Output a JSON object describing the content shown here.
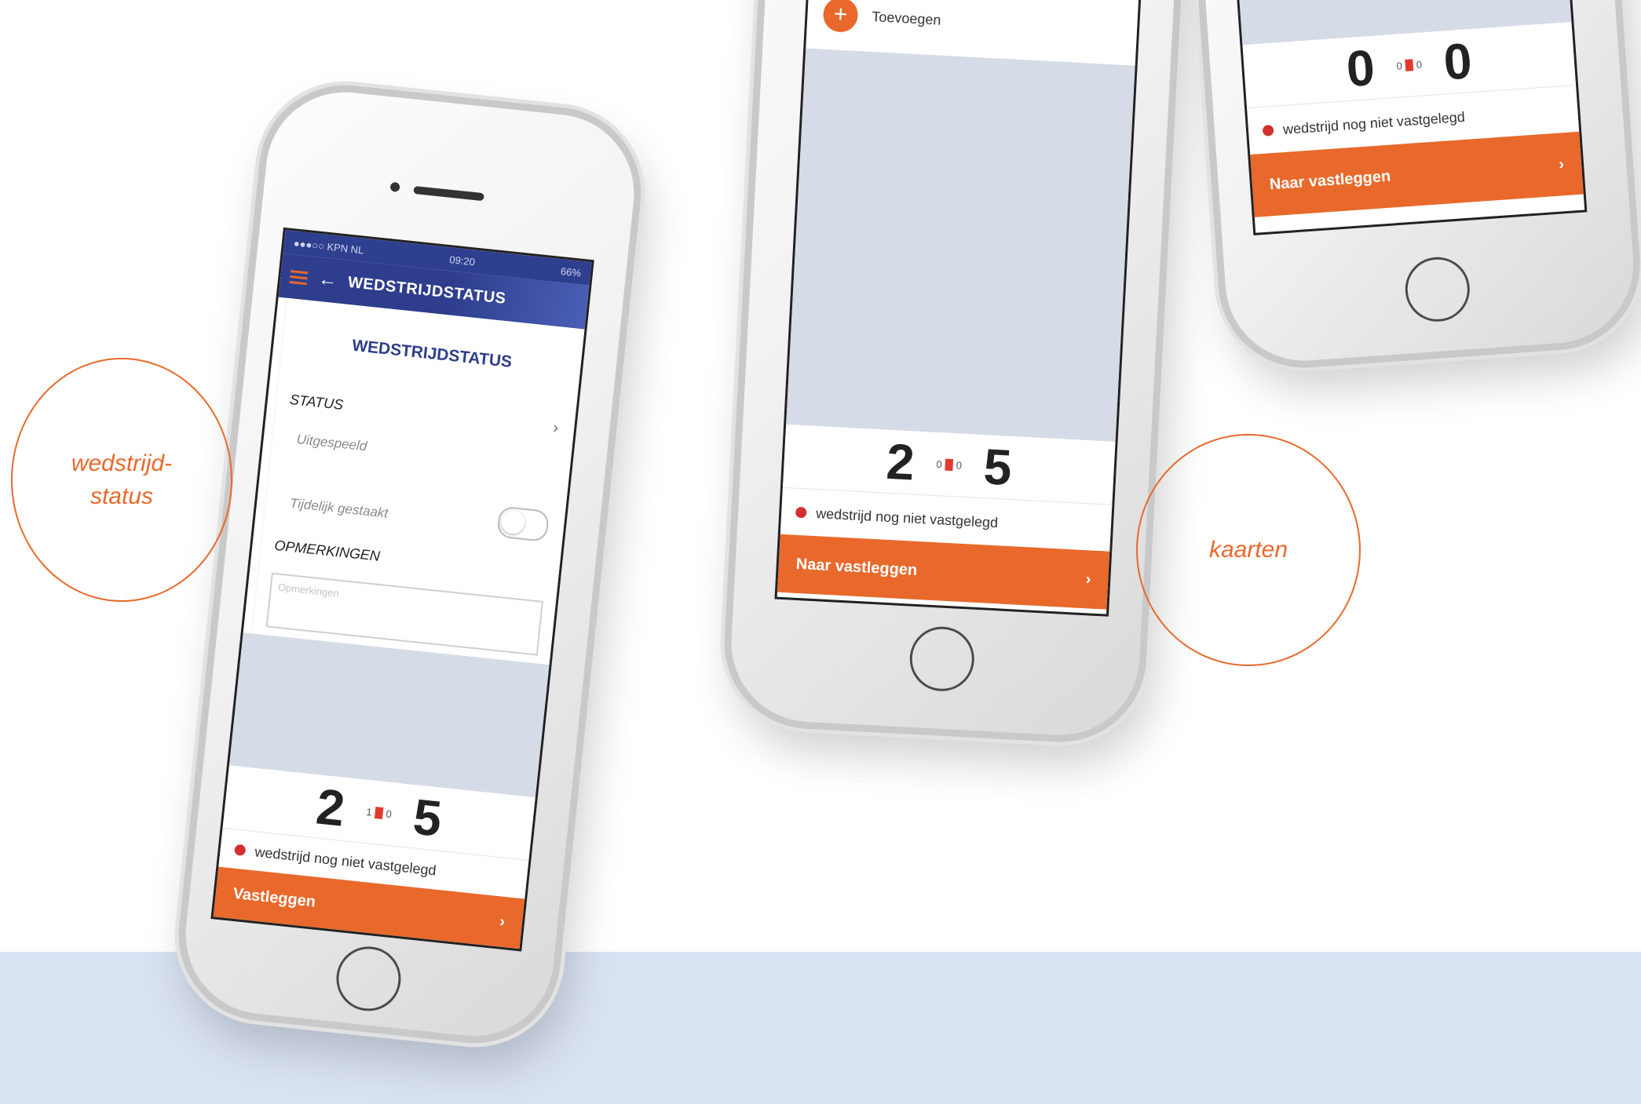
{
  "phone_left": {
    "status_bar": {
      "carrier": "●●●○○ KPN NL",
      "time": "09:20",
      "battery": "66%"
    },
    "navbar_title": "WEDSTRIJDSTATUS",
    "card_title": "WEDSTRIJDSTATUS",
    "status_label": "STATUS",
    "options": [
      "Uitgespeeld",
      "Tijdelijk gestaakt"
    ],
    "remarks_label": "OPMERKINGEN",
    "remarks_placeholder": "Opmerkingen",
    "score_home": "2",
    "score_away": "5",
    "cards_home": "1",
    "cards_away": "0",
    "status_text": "wedstrijd nog niet vastgelegd",
    "button_label": "Vastleggen",
    "chevron": "›"
  },
  "phone_middle": {
    "add_label": "Toevoegen",
    "score_home": "2",
    "score_away": "5",
    "cards_home": "0",
    "cards_away": "0",
    "status_text": "wedstrijd nog niet vastgelegd",
    "button_label": "Naar vastleggen",
    "chevron": "›"
  },
  "phone_right": {
    "score_home": "0",
    "score_away": "0",
    "cards_home": "0",
    "cards_away": "0",
    "status_text": "wedstrijd nog niet vastgelegd",
    "button_label": "Naar vastleggen",
    "chevron": "›"
  },
  "annotations": {
    "left_line1": "wedstrijd-",
    "left_line2": "status",
    "right": "kaarten"
  },
  "colors": {
    "accent": "#e8692b",
    "nav": "#2e3e8c",
    "band": "#d9e2f3"
  }
}
